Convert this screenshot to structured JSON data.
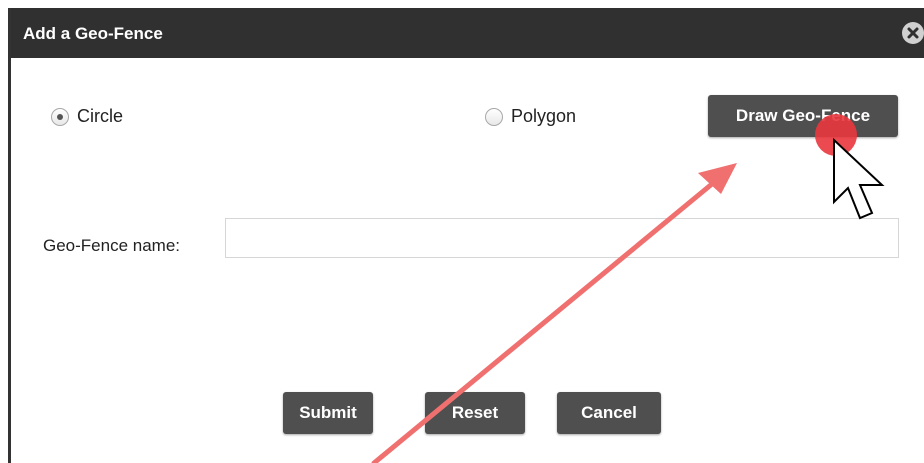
{
  "dialog": {
    "title": "Add a Geo-Fence",
    "close_icon": "close-circle-icon"
  },
  "shape_options": [
    {
      "label": "Circle",
      "checked": true
    },
    {
      "label": "Polygon",
      "checked": false
    }
  ],
  "draw_button": {
    "label": "Draw Geo-Fence"
  },
  "name_field": {
    "label": "Geo-Fence name:",
    "value": "",
    "placeholder": ""
  },
  "actions": {
    "submit_label": "Submit",
    "reset_label": "Reset",
    "cancel_label": "Cancel"
  },
  "annotation": {
    "arrow_color": "#f07070",
    "click_marker_color": "#e8363d",
    "cursor_icon": "mouse-pointer-icon"
  }
}
